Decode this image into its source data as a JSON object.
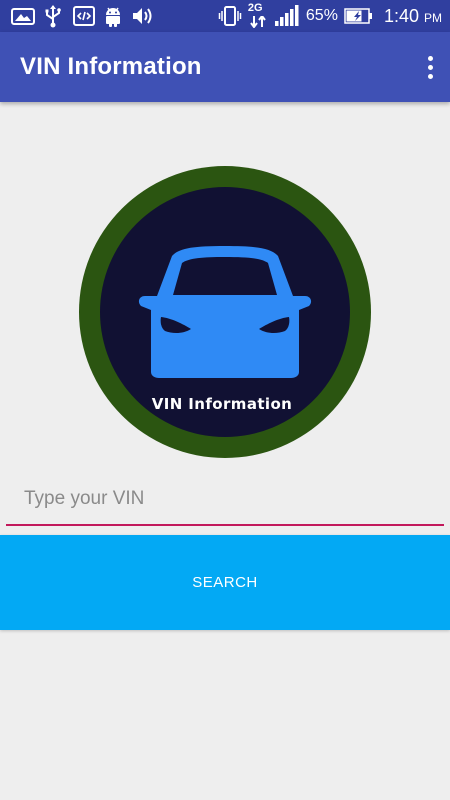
{
  "status_bar": {
    "battery_percent": "65%",
    "time": "1:40",
    "ampm": "PM",
    "network": "2G",
    "icons": [
      "gallery-icon",
      "usb-icon",
      "code-icon",
      "android-icon",
      "volume-icon",
      "vibrate-icon",
      "network-2g-icon",
      "signal-icon",
      "battery-charging-icon"
    ]
  },
  "app_bar": {
    "title": "VIN Information",
    "menu_icon": "overflow-menu-icon",
    "color": "#3f51b5"
  },
  "logo": {
    "caption": "VIN Information",
    "icon": "car-icon",
    "ring_color": "#2b5511",
    "inner_color": "#111133",
    "car_color": "#2f8af5"
  },
  "form": {
    "vin_value": "",
    "vin_placeholder": "Type your VIN",
    "search_label": "SEARCH",
    "button_color": "#03a9f4",
    "underline_color": "#c2185b"
  }
}
